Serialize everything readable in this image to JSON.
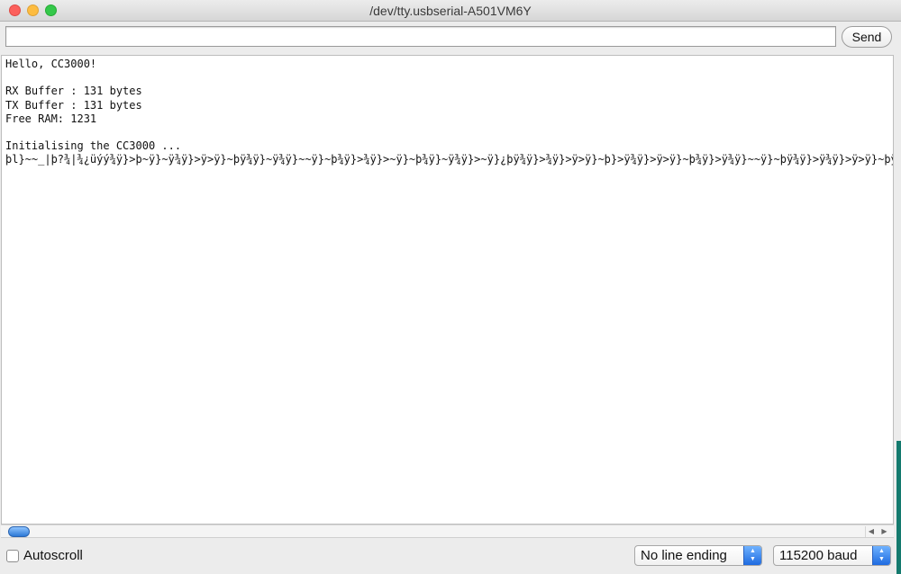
{
  "window": {
    "title": "/dev/tty.usbserial-A501VM6Y"
  },
  "toolbar": {
    "input_value": "",
    "send_label": "Send"
  },
  "output": {
    "lines": [
      "Hello, CC3000!",
      "",
      "RX Buffer : 131 bytes",
      "TX Buffer : 131 bytes",
      "Free RAM: 1231",
      "",
      "Initialising the CC3000 ...",
      "þl}~~_|þ?¾|¾¿üýý¾ÿ}>þ~ÿ}~ÿ¾ÿ}>ÿ>ÿ}~þÿ¾ÿ}~ÿ¾ÿ}~~ÿ}~þ¾ÿ}>¾ÿ}>~ÿ}~þ¾ÿ}~ÿ¾ÿ}>~ÿ}¿þÿ¾ÿ}>¾ÿ}>ÿ>ÿ}~þ}>ÿ¾ÿ}>ÿ>ÿ}~þ¾ÿ}>ÿ¾ÿ}~~ÿ}~þÿ¾ÿ}>ÿ¾ÿ}>ÿ>ÿ}~þÿ¾ÿ}>ÿ¾ÿ}>~ÿ}~þ"
    ]
  },
  "footer": {
    "autoscroll_label": "Autoscroll",
    "autoscroll_checked": false,
    "line_ending": "No line ending",
    "baud": "115200 baud"
  }
}
